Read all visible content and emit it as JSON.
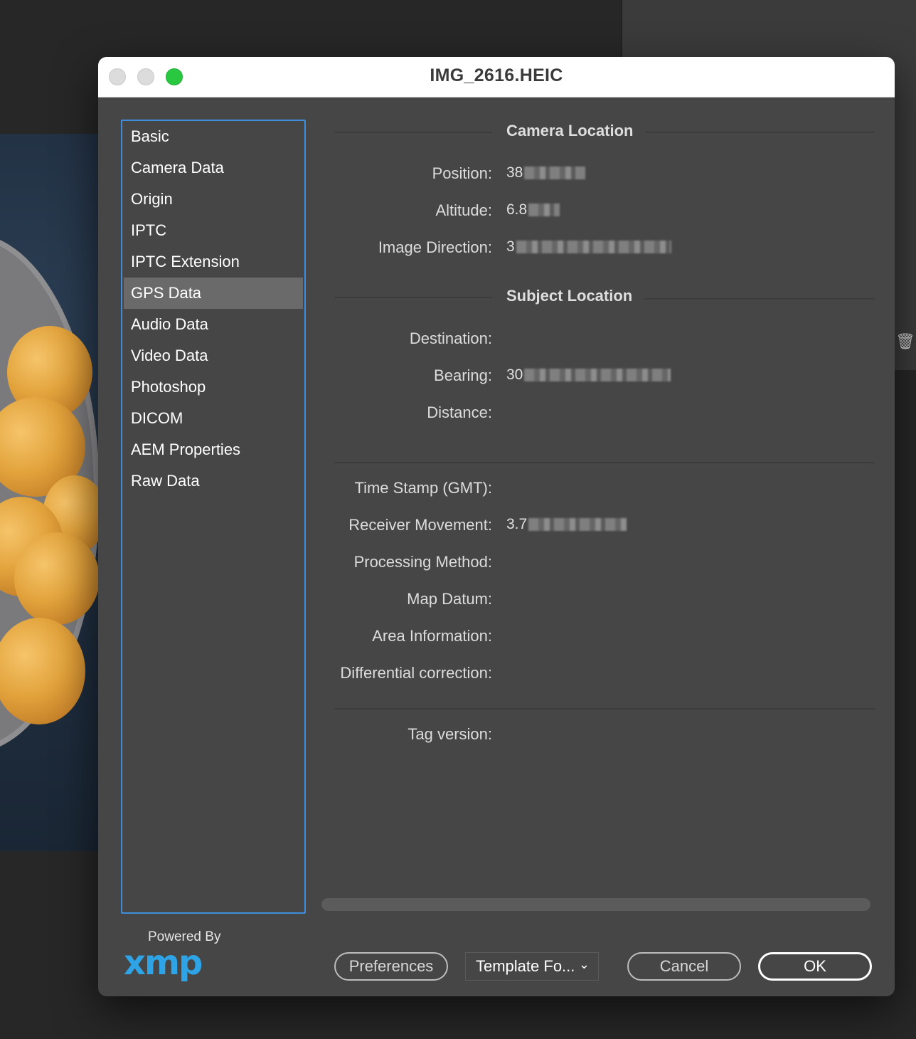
{
  "background": {
    "trash_icon": "trash-icon"
  },
  "dialog": {
    "title": "IMG_2616.HEIC",
    "accent_color": "#3f8ede"
  },
  "sidebar": {
    "selected": "GPS Data",
    "items": [
      {
        "label": "Basic"
      },
      {
        "label": "Camera Data"
      },
      {
        "label": "Origin"
      },
      {
        "label": "IPTC"
      },
      {
        "label": "IPTC Extension"
      },
      {
        "label": "GPS Data"
      },
      {
        "label": "Audio Data"
      },
      {
        "label": "Video Data"
      },
      {
        "label": "Photoshop"
      },
      {
        "label": "DICOM"
      },
      {
        "label": "AEM Properties"
      },
      {
        "label": "Raw Data"
      }
    ]
  },
  "camera_location": {
    "heading": "Camera Location",
    "position": {
      "label": "Position:",
      "value_visible": "38"
    },
    "altitude": {
      "label": "Altitude:",
      "value_visible": "6.8"
    },
    "image_direction": {
      "label": "Image Direction:",
      "value_visible": "3"
    }
  },
  "subject_location": {
    "heading": "Subject Location",
    "destination": {
      "label": "Destination:",
      "value": ""
    },
    "bearing": {
      "label": "Bearing:",
      "value_visible": "30"
    },
    "distance": {
      "label": "Distance:",
      "value": ""
    }
  },
  "gps_meta": {
    "time_stamp": {
      "label": "Time Stamp (GMT):",
      "value": ""
    },
    "receiver_movement": {
      "label": "Receiver Movement:",
      "value_visible": "3.7"
    },
    "processing_method": {
      "label": "Processing Method:",
      "value": ""
    },
    "map_datum": {
      "label": "Map Datum:",
      "value": ""
    },
    "area_information": {
      "label": "Area Information:",
      "value": ""
    },
    "differential_correction": {
      "label": "Differential correction:",
      "value": ""
    },
    "tag_version": {
      "label": "Tag version:",
      "value": ""
    }
  },
  "footer": {
    "powered_by": "Powered By",
    "logo_text": "xmp",
    "preferences_label": "Preferences",
    "template_label": "Template Fo...",
    "cancel_label": "Cancel",
    "ok_label": "OK"
  }
}
